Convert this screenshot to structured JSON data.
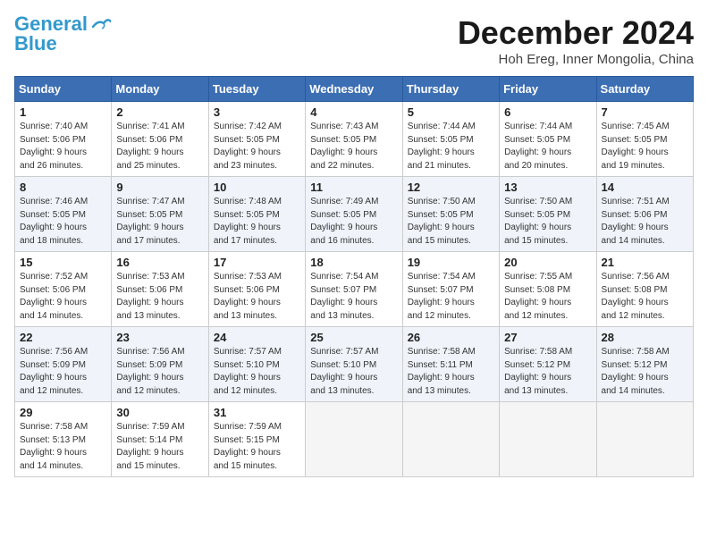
{
  "header": {
    "logo_line1": "General",
    "logo_line2": "Blue",
    "month": "December 2024",
    "location": "Hoh Ereg, Inner Mongolia, China"
  },
  "weekdays": [
    "Sunday",
    "Monday",
    "Tuesday",
    "Wednesday",
    "Thursday",
    "Friday",
    "Saturday"
  ],
  "weeks": [
    [
      {
        "day": "1",
        "info": "Sunrise: 7:40 AM\nSunset: 5:06 PM\nDaylight: 9 hours\nand 26 minutes."
      },
      {
        "day": "2",
        "info": "Sunrise: 7:41 AM\nSunset: 5:06 PM\nDaylight: 9 hours\nand 25 minutes."
      },
      {
        "day": "3",
        "info": "Sunrise: 7:42 AM\nSunset: 5:05 PM\nDaylight: 9 hours\nand 23 minutes."
      },
      {
        "day": "4",
        "info": "Sunrise: 7:43 AM\nSunset: 5:05 PM\nDaylight: 9 hours\nand 22 minutes."
      },
      {
        "day": "5",
        "info": "Sunrise: 7:44 AM\nSunset: 5:05 PM\nDaylight: 9 hours\nand 21 minutes."
      },
      {
        "day": "6",
        "info": "Sunrise: 7:44 AM\nSunset: 5:05 PM\nDaylight: 9 hours\nand 20 minutes."
      },
      {
        "day": "7",
        "info": "Sunrise: 7:45 AM\nSunset: 5:05 PM\nDaylight: 9 hours\nand 19 minutes."
      }
    ],
    [
      {
        "day": "8",
        "info": "Sunrise: 7:46 AM\nSunset: 5:05 PM\nDaylight: 9 hours\nand 18 minutes."
      },
      {
        "day": "9",
        "info": "Sunrise: 7:47 AM\nSunset: 5:05 PM\nDaylight: 9 hours\nand 17 minutes."
      },
      {
        "day": "10",
        "info": "Sunrise: 7:48 AM\nSunset: 5:05 PM\nDaylight: 9 hours\nand 17 minutes."
      },
      {
        "day": "11",
        "info": "Sunrise: 7:49 AM\nSunset: 5:05 PM\nDaylight: 9 hours\nand 16 minutes."
      },
      {
        "day": "12",
        "info": "Sunrise: 7:50 AM\nSunset: 5:05 PM\nDaylight: 9 hours\nand 15 minutes."
      },
      {
        "day": "13",
        "info": "Sunrise: 7:50 AM\nSunset: 5:05 PM\nDaylight: 9 hours\nand 15 minutes."
      },
      {
        "day": "14",
        "info": "Sunrise: 7:51 AM\nSunset: 5:06 PM\nDaylight: 9 hours\nand 14 minutes."
      }
    ],
    [
      {
        "day": "15",
        "info": "Sunrise: 7:52 AM\nSunset: 5:06 PM\nDaylight: 9 hours\nand 14 minutes."
      },
      {
        "day": "16",
        "info": "Sunrise: 7:53 AM\nSunset: 5:06 PM\nDaylight: 9 hours\nand 13 minutes."
      },
      {
        "day": "17",
        "info": "Sunrise: 7:53 AM\nSunset: 5:06 PM\nDaylight: 9 hours\nand 13 minutes."
      },
      {
        "day": "18",
        "info": "Sunrise: 7:54 AM\nSunset: 5:07 PM\nDaylight: 9 hours\nand 13 minutes."
      },
      {
        "day": "19",
        "info": "Sunrise: 7:54 AM\nSunset: 5:07 PM\nDaylight: 9 hours\nand 12 minutes."
      },
      {
        "day": "20",
        "info": "Sunrise: 7:55 AM\nSunset: 5:08 PM\nDaylight: 9 hours\nand 12 minutes."
      },
      {
        "day": "21",
        "info": "Sunrise: 7:56 AM\nSunset: 5:08 PM\nDaylight: 9 hours\nand 12 minutes."
      }
    ],
    [
      {
        "day": "22",
        "info": "Sunrise: 7:56 AM\nSunset: 5:09 PM\nDaylight: 9 hours\nand 12 minutes."
      },
      {
        "day": "23",
        "info": "Sunrise: 7:56 AM\nSunset: 5:09 PM\nDaylight: 9 hours\nand 12 minutes."
      },
      {
        "day": "24",
        "info": "Sunrise: 7:57 AM\nSunset: 5:10 PM\nDaylight: 9 hours\nand 12 minutes."
      },
      {
        "day": "25",
        "info": "Sunrise: 7:57 AM\nSunset: 5:10 PM\nDaylight: 9 hours\nand 13 minutes."
      },
      {
        "day": "26",
        "info": "Sunrise: 7:58 AM\nSunset: 5:11 PM\nDaylight: 9 hours\nand 13 minutes."
      },
      {
        "day": "27",
        "info": "Sunrise: 7:58 AM\nSunset: 5:12 PM\nDaylight: 9 hours\nand 13 minutes."
      },
      {
        "day": "28",
        "info": "Sunrise: 7:58 AM\nSunset: 5:12 PM\nDaylight: 9 hours\nand 14 minutes."
      }
    ],
    [
      {
        "day": "29",
        "info": "Sunrise: 7:58 AM\nSunset: 5:13 PM\nDaylight: 9 hours\nand 14 minutes."
      },
      {
        "day": "30",
        "info": "Sunrise: 7:59 AM\nSunset: 5:14 PM\nDaylight: 9 hours\nand 15 minutes."
      },
      {
        "day": "31",
        "info": "Sunrise: 7:59 AM\nSunset: 5:15 PM\nDaylight: 9 hours\nand 15 minutes."
      },
      null,
      null,
      null,
      null
    ]
  ]
}
